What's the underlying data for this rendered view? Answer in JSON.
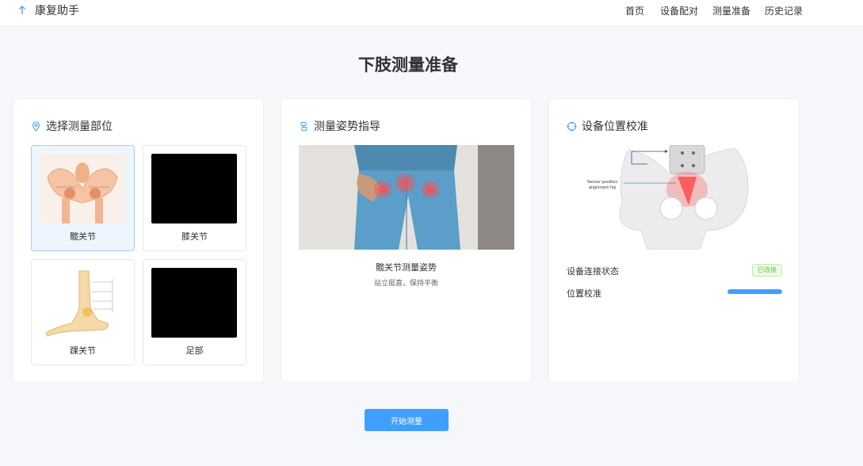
{
  "app": {
    "title": "康复助手"
  },
  "nav": {
    "home": "首页",
    "pairing": "设备配对",
    "prep": "测量准备",
    "history": "历史记录"
  },
  "page": {
    "title": "下肢测量准备"
  },
  "select_part": {
    "title": "选择测量部位",
    "parts": [
      {
        "label": "髋关节",
        "selected": true
      },
      {
        "label": "膝关节",
        "selected": false
      },
      {
        "label": "踝关节",
        "selected": false
      },
      {
        "label": "足部",
        "selected": false
      }
    ]
  },
  "posture": {
    "title": "测量姿势指导",
    "caption": "髋关节测量姿势",
    "subcaption": "站立挺直，保持平衡"
  },
  "calibration": {
    "title": "设备位置校准",
    "image_label_top": "Sensor position",
    "image_label_bottom": "alignment hip",
    "connection_label": "设备连接状态",
    "connection_status": "已连接",
    "calibration_label": "位置校准",
    "calibration_progress": 1.0
  },
  "actions": {
    "start": "开始测量"
  },
  "colors": {
    "accent": "#409eff",
    "success": "#67c23a",
    "selected_bg": "#edf5ff"
  }
}
